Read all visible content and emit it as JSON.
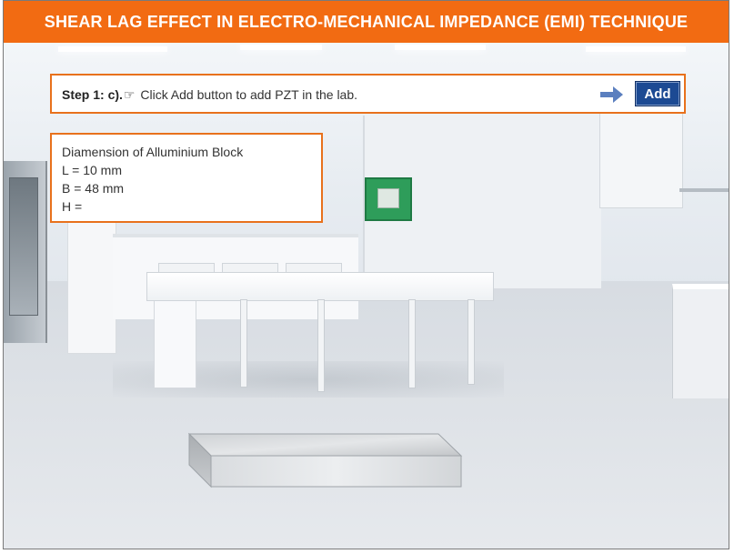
{
  "header": {
    "title": "SHEAR LAG EFFECT IN ELECTRO-MECHANICAL IMPEDANCE (EMI) TECHNIQUE"
  },
  "instruction": {
    "step_label": "Step 1: c).",
    "text": " Click Add button to add PZT in the lab.",
    "hand_icon": "pointing-hand-icon",
    "arrow_icon": "arrow-right-icon"
  },
  "add_button": {
    "label": "Add"
  },
  "dimensions": {
    "heading": "Diamension of Alluminium Block",
    "L": "L = 10 mm",
    "B": "B = 48 mm",
    "H": "H ="
  },
  "colors": {
    "header_bg": "#f26b12",
    "panel_border": "#e8711c",
    "button_bg": "#1c4a93",
    "arrow": "#5b7fbf"
  },
  "scene": {
    "object": "aluminium-block"
  }
}
